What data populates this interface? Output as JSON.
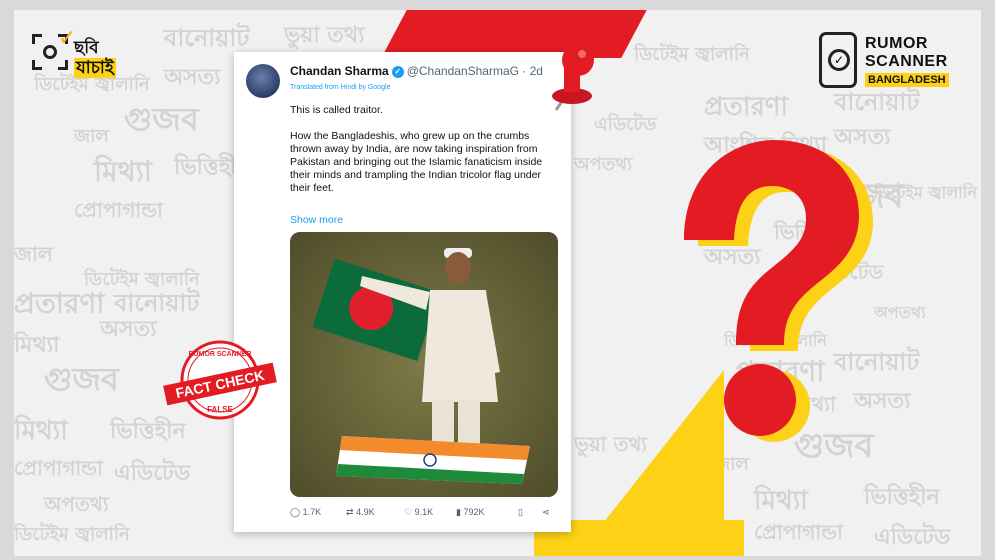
{
  "logo_left": {
    "line1": "ছবি",
    "line2": "যাচাই"
  },
  "logo_right": {
    "line1": "RUMOR",
    "line2": "SCANNER",
    "line3": "BANGLADESH"
  },
  "background_words": [
    "গুজব",
    "বানোয়াট",
    "ভুয়া তথ্য",
    "অসত্য",
    "মিথ্যা",
    "ভিত্তিহীন",
    "প্রোপাগান্ডা",
    "এডিটেড",
    "প্রতারণা",
    "আংশিক মিথ্যা",
    "জাল",
    "অপতথ্য",
    "ডিটেইম জ্বালানি"
  ],
  "tweet": {
    "author_name": "Chandan Sharma",
    "verified_mark": "✓",
    "handle": "@ChandanSharmaG · 2d",
    "translated": "Translated from Hindi by Google",
    "line1": "This is called traitor.",
    "body": "How the Bangladeshis, who grew up on the crumbs thrown away by India, are now taking inspiration from Pakistan and bringing out the Islamic fanaticism inside their minds and trampling the Indian tricolor flag under their feet.",
    "show_more": "Show more",
    "stats": {
      "replies": "1.7K",
      "reposts": "4.9K",
      "likes": "9.1K",
      "views": "792K"
    }
  },
  "stamp": {
    "top": "RUMOR SCANNER",
    "main": "FACT CHECK",
    "verdict": "FALSE"
  },
  "colors": {
    "red": "#e31c23",
    "yellow": "#fcd116",
    "blue": "#1d9bf0"
  },
  "icons": [
    "reply-icon",
    "repost-icon",
    "like-icon",
    "views-icon",
    "bookmark-icon",
    "share-icon",
    "pushpin-icon",
    "question-mark-icon"
  ]
}
